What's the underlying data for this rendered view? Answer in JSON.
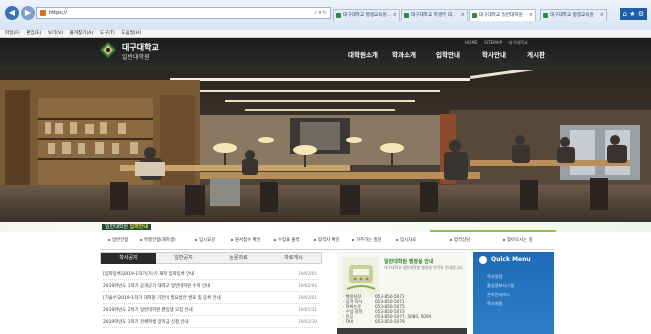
{
  "browser": {
    "url": "https://",
    "tabs": [
      {
        "label": "대구대학교 평생교육원...",
        "close": "×"
      },
      {
        "label": "대구대학교 학생부 대..",
        "close": "×"
      },
      {
        "label": "대구대학교 일반대학원",
        "close": "×"
      },
      {
        "label": "대구대학교 평생교육원",
        "close": "×"
      }
    ],
    "menu": [
      "파일(F)",
      "편집(E)",
      "보기(V)",
      "즐겨찾기(A)",
      "도구(T)",
      "도움말(H)"
    ]
  },
  "header": {
    "logo_line1": "대구대학교",
    "logo_line2": "일반대학원",
    "top_links": [
      "HOME",
      "SITEMAP",
      "대구대학교"
    ],
    "nav": [
      "대학원소개",
      "학과소개",
      "입학안내",
      "학사안내",
      "게시판"
    ]
  },
  "stripe": {
    "label_prefix": "일반대학원",
    "label_main": "입학안내"
  },
  "quick_links": [
    "일반전형",
    "특별전형(재학생)",
    "입시요강",
    "원서접수 확인",
    "수험표 출력",
    "합격자 확인",
    "가주하는 질문",
    "입시자료",
    "합격상담",
    "찾아오시는 길"
  ],
  "board": {
    "tabs": [
      "학사공지",
      "일반공지",
      "논문자료",
      "자료게시"
    ],
    "active_tab": 0,
    "rows": [
      {
        "title": "[입학등록]2019-1학기(가)기 재학 입학등록 안내",
        "date": "19/02/05"
      },
      {
        "title": "2019학년도 1학기 공개공가 대학교 일반대학원 수학 안내",
        "date": "19/02/04"
      },
      {
        "title": "[기술수]2019-1학기 대학원 기본이 필요방안 발표 및 등록 안내",
        "date": "19/02/01"
      },
      {
        "title": "2019학년도 2학기 일반대학원 편입생 모집 안내",
        "date": "19/01/31"
      },
      {
        "title": "2019학년도 1학기 전체학생 장학금 신청 안내",
        "date": "19/01/30"
      }
    ]
  },
  "contact": {
    "title": "일반대학원 행정실 안내",
    "desc": "대구대학교 일반대학원 행정실 연락처 안내입니다.",
    "lines": [
      {
        "label": "· 행정실장",
        "num": "053-850-5072"
      },
      {
        "label": "· 입학·학사",
        "num": "053-850-5071"
      },
      {
        "label": "· 학위논문",
        "num": "053-850-5075"
      },
      {
        "label": "· 수업·장학",
        "num": "053-850-5073"
      },
      {
        "label": "· 전공",
        "num": "053-850-5077, 5080, 5094"
      },
      {
        "label": "· FAX",
        "num": "053-850-5079"
      }
    ]
  },
  "quick_menu": {
    "title": "Quick Menu",
    "items": [
      "학사일정",
      "졸업정보시스템",
      "온라인서비스",
      "학사지원"
    ]
  },
  "colors": {
    "header_bg": "#1a1d1c",
    "accent_green": "#8ac43f",
    "quick_menu_blue": "#1f6ab7",
    "board_active": "#2a2a2a"
  }
}
